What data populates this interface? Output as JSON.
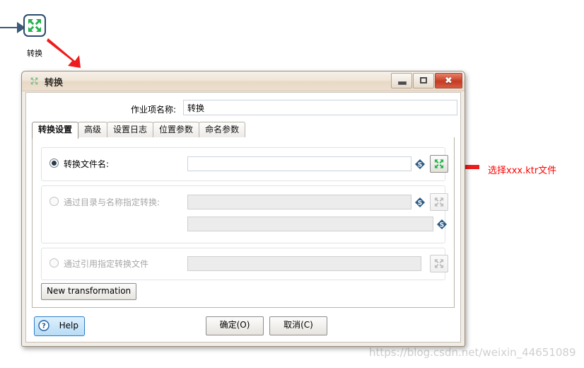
{
  "canvas": {
    "entry": {
      "icon": "transformation-icon",
      "label": "转换"
    },
    "annotation": {
      "text": "选择xxx.ktr文件",
      "color": "#ff0000"
    },
    "watermark": "https://blog.csdn.net/weixin_44651089"
  },
  "dialog": {
    "title": "转换",
    "title_icon": "transformation-icon",
    "window_buttons": {
      "minimize": "–",
      "maximize": "□",
      "close": "✖"
    },
    "name_field": {
      "label": "作业项名称:",
      "value": "转换",
      "placeholder": ""
    },
    "tabs": [
      {
        "label": "转换设置",
        "active": true
      },
      {
        "label": "高级",
        "active": false
      },
      {
        "label": "设置日志",
        "active": false
      },
      {
        "label": "位置参数",
        "active": false
      },
      {
        "label": "命名参数",
        "active": false
      }
    ],
    "groups": {
      "by_filename": {
        "radio_label": "转换文件名:",
        "selected": true,
        "enabled": true,
        "input_value": "",
        "variable_icon": "dollar-diamond-icon",
        "browse_icon": "transformation-icon"
      },
      "by_directory": {
        "radio_label": "通过目录与名称指定转换:",
        "selected": false,
        "enabled": false,
        "input_value": "",
        "input2_value": "",
        "variable_icon": "dollar-diamond-icon",
        "browse_icon": "transformation-icon"
      },
      "by_reference": {
        "radio_label": "通过引用指定转换文件",
        "selected": false,
        "enabled": false,
        "input_value": "",
        "browse_icon": "transformation-icon"
      }
    },
    "new_transformation_button": "New transformation",
    "buttons": {
      "ok": "确定(O)",
      "cancel": "取消(C)",
      "help": "Help",
      "help_icon": "question-circle-icon"
    }
  },
  "colors": {
    "accent_green": "#22b24c",
    "icon_border": "#2b4a6f",
    "annotation_red": "#ff0000",
    "titlebar": "#eddfd0",
    "close_button": "#c53b23",
    "help_border": "#2a7fc9"
  }
}
